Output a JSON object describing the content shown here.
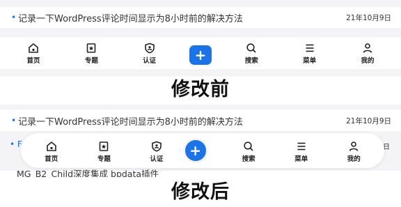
{
  "post": {
    "title": "记录一下WordPress评论时间显示为8小时前的解决方法",
    "date": "21年10月9日",
    "peek_title": "F",
    "peek_date": "7日",
    "cut_title": "MG_B2_Child深度集成 bpdata插件"
  },
  "nav": {
    "home": "首页",
    "topics": "专题",
    "verify": "认证",
    "add": "+",
    "search": "搜索",
    "menu": "菜单",
    "mine": "我的"
  },
  "captions": {
    "before": "修改前",
    "after": "修改后"
  },
  "colors": {
    "accent": "#1a73e8",
    "panel_bg": "#f4f4f6"
  }
}
